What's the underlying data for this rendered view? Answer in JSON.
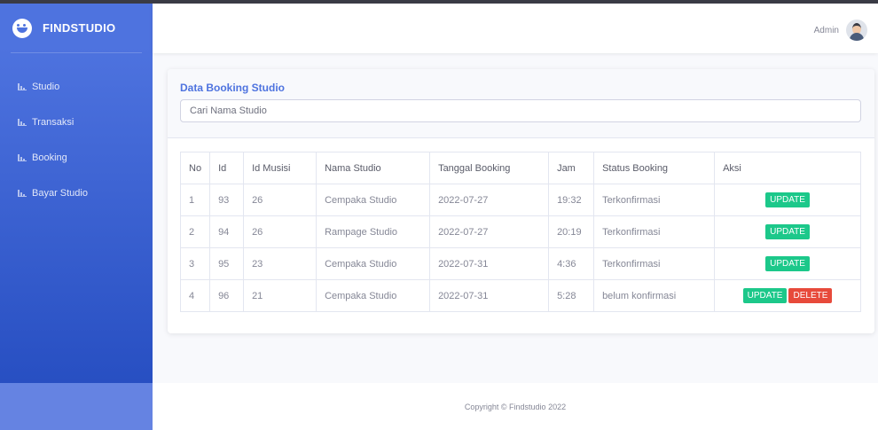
{
  "brand": {
    "name": "FINDSTUDIO",
    "icon": "laugh-face-icon"
  },
  "sidebar": {
    "items": [
      {
        "label": "Studio",
        "icon": "chart-area-icon"
      },
      {
        "label": "Transaksi",
        "icon": "chart-area-icon"
      },
      {
        "label": "Booking",
        "icon": "chart-area-icon"
      },
      {
        "label": "Bayar Studio",
        "icon": "chart-area-icon"
      }
    ]
  },
  "topbar": {
    "user_name": "Admin"
  },
  "card": {
    "title": "Data Booking Studio",
    "search_placeholder": "Cari Nama Studio"
  },
  "table": {
    "headers": [
      "No",
      "Id",
      "Id Musisi",
      "Nama Studio",
      "Tanggal Booking",
      "Jam",
      "Status Booking",
      "Aksi"
    ],
    "rows": [
      {
        "no": "1",
        "id": "93",
        "id_musisi": "26",
        "nama_studio": "Cempaka Studio",
        "tanggal": "2022-07-27",
        "jam": "19:32",
        "status": "Terkonfirmasi",
        "update": "UPDATE",
        "delete": null
      },
      {
        "no": "2",
        "id": "94",
        "id_musisi": "26",
        "nama_studio": "Rampage Studio",
        "tanggal": "2022-07-27",
        "jam": "20:19",
        "status": "Terkonfirmasi",
        "update": "UPDATE",
        "delete": null
      },
      {
        "no": "3",
        "id": "95",
        "id_musisi": "23",
        "nama_studio": "Cempaka Studio",
        "tanggal": "2022-07-31",
        "jam": "4:36",
        "status": "Terkonfirmasi",
        "update": "UPDATE",
        "delete": null
      },
      {
        "no": "4",
        "id": "96",
        "id_musisi": "21",
        "nama_studio": "Cempaka Studio",
        "tanggal": "2022-07-31",
        "jam": "5:28",
        "status": "belum konfirmasi",
        "update": "UPDATE",
        "delete": "DELETE"
      }
    ]
  },
  "footer": {
    "copyright": "Copyright © Findstudio 2022"
  },
  "colors": {
    "primary": "#4e73df",
    "success": "#1cc88a",
    "danger": "#e74a3b"
  }
}
